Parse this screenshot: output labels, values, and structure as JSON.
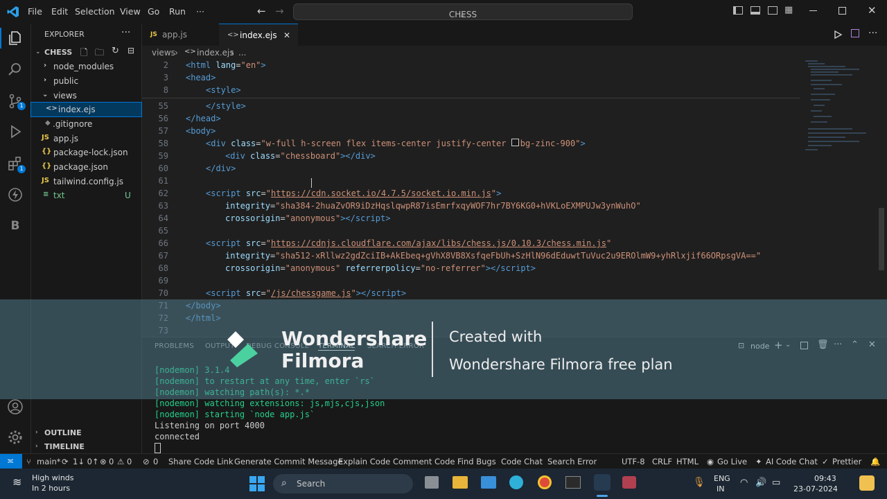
{
  "menu": {
    "file": "File",
    "edit": "Edit",
    "selection": "Selection",
    "view": "View",
    "go": "Go",
    "run": "Run",
    "more": "···"
  },
  "search": {
    "label": "CHESS"
  },
  "explorer": {
    "title": "EXPLORER",
    "folder": "CHESS",
    "items": [
      {
        "label": "node_modules",
        "kind": "folder"
      },
      {
        "label": "public",
        "kind": "folder"
      },
      {
        "label": "views",
        "kind": "folder-open"
      },
      {
        "label": "index.ejs",
        "kind": "ejs"
      },
      {
        "label": ".gitignore",
        "kind": "git"
      },
      {
        "label": "app.js",
        "kind": "js"
      },
      {
        "label": "package-lock.json",
        "kind": "json"
      },
      {
        "label": "package.json",
        "kind": "json"
      },
      {
        "label": "tailwind.config.js",
        "kind": "js"
      },
      {
        "label": "txt",
        "kind": "txt",
        "badge": "U"
      }
    ],
    "outline": "OUTLINE",
    "timeline": "TIMELINE"
  },
  "activity": {
    "badge_scm": "1",
    "badge_ext": "1"
  },
  "tabs": [
    {
      "label": "app.js",
      "icon": "JS"
    },
    {
      "label": "index.ejs",
      "icon": "<>"
    }
  ],
  "breadcrumb": {
    "folder": "views",
    "file": "index.ejs",
    "more": "..."
  },
  "code": {
    "lines": [
      {
        "n": "2"
      },
      {
        "n": "3"
      },
      {
        "n": "8"
      },
      {
        "n": "55"
      },
      {
        "n": "56"
      },
      {
        "n": "57"
      },
      {
        "n": "58"
      },
      {
        "n": "59"
      },
      {
        "n": "60"
      },
      {
        "n": "61"
      },
      {
        "n": "62"
      },
      {
        "n": "63"
      },
      {
        "n": "64"
      },
      {
        "n": "65"
      },
      {
        "n": "66"
      },
      {
        "n": "67"
      },
      {
        "n": "68"
      },
      {
        "n": "69"
      },
      {
        "n": "70"
      },
      {
        "n": "71"
      },
      {
        "n": "72"
      },
      {
        "n": "73"
      }
    ],
    "html_open": "<html",
    "lang_attr": "lang",
    "lang_val": "\"en\"",
    "head": "<head>",
    "style": "<style>",
    "style_close": "</style>",
    "head_close": "</head>",
    "body": "<body>",
    "div_class": "\"w-full h-screen flex items-center justify-center ",
    "bg": "bg-zinc-900\"",
    "board_class": "\"chessboard\"",
    "div_close": "</div>",
    "socket_src": "https://cdn.socket.io/4.7.5/socket.io.min.js",
    "socket_integrity": "\"sha384-2huaZvOR9iDzHqslqwpR87isEmrfxqyWOF7hr7BY6KG0+hVKLoEXMPUJw3ynWuhO\"",
    "anon": "\"anonymous\"",
    "chess_src": "https://cdnjs.cloudflare.com/ajax/libs/chess.js/0.10.3/chess.min.js",
    "chess_integrity": "\"sha512-xRllwz2gdZciIB+AkEbeq+gVhX8VB8XsfqeFbUh+SzHlN96dEduwtTuVuc2u9EROlmW9+yhRlxjif66ORpsgVA==\"",
    "noref": "\"no-referrer\"",
    "game_src": "/js/chessgame.js",
    "body_close": "</body>",
    "html_close": "</html>"
  },
  "panel": {
    "tabs": [
      "PROBLEMS",
      "OUTPUT",
      "DEBUG CONSOLE",
      "TERMINAL",
      "SEARCH ERROR"
    ],
    "shell": "node",
    "terminal": [
      "[nodemon] 3.1.4",
      "[nodemon] to restart at any time, enter `rs`",
      "[nodemon] watching path(s): *.*",
      "[nodemon] watching extensions: js,mjs,cjs,json",
      "[nodemon] starting `node app.js`",
      "Listening on port 4000",
      "connected"
    ]
  },
  "watermark": {
    "brand1": "Wondershare",
    "brand2": "Filmora",
    "created": "Created with",
    "plan": "Wondershare Filmora free plan"
  },
  "status": {
    "branch": "main*",
    "sync": "1↓ 0↑",
    "errors": "0",
    "warnings": "0",
    "ports": "0",
    "items": [
      "Share Code Link",
      "Generate Commit Message",
      "Explain Code",
      "Comment Code",
      "Find Bugs",
      "Code Chat",
      "Search Error"
    ],
    "encoding": "UTF-8",
    "eol": "CRLF",
    "lang": "HTML",
    "golive": "Go Live",
    "aichat": "AI Code Chat",
    "prettier": "Prettier"
  },
  "taskbar": {
    "weather1": "High winds",
    "weather2": "In 2 hours",
    "search": "Search",
    "lang1": "ENG",
    "lang2": "IN",
    "time": "09:43",
    "date": "23-07-2024"
  }
}
